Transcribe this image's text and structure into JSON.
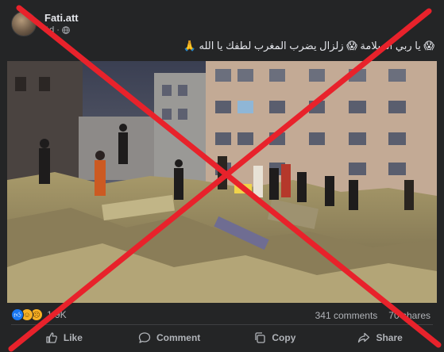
{
  "post": {
    "author": "Fati.att",
    "time": "1d",
    "caption": "😱 يا ربي السلامة 😱 زلزال يضرب المغرب لطفك يا الله 🙏",
    "audience_icon": "globe-icon"
  },
  "reactions": {
    "types": [
      "like",
      "care",
      "sad"
    ],
    "count": "1.9K"
  },
  "stats": {
    "comments": "341 comments",
    "shares": "70 shares"
  },
  "actions": {
    "like": "Like",
    "comment": "Comment",
    "copy": "Copy",
    "share": "Share"
  },
  "overlay": {
    "type": "red X",
    "color": "#e8222b"
  },
  "colors": {
    "background": "#242526",
    "text_primary": "#e4e6eb",
    "text_secondary": "#b0b3b8",
    "like_blue": "#1877f2"
  }
}
